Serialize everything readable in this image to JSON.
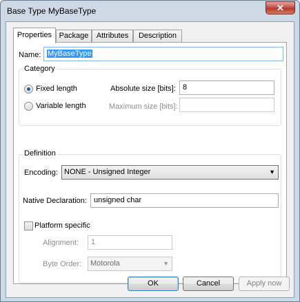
{
  "window": {
    "title": "Base Type MyBaseType",
    "close_glyph": "✕"
  },
  "tabs": [
    {
      "label": "Properties",
      "active": true
    },
    {
      "label": "Package",
      "active": false
    },
    {
      "label": "Attributes",
      "active": false
    },
    {
      "label": "Description",
      "active": false
    }
  ],
  "name": {
    "label": "Name:",
    "value": "MyBaseType"
  },
  "category": {
    "title": "Category",
    "fixed_length": "Fixed length",
    "variable_length": "Variable length",
    "selected": "fixed_length",
    "absolute_size_label": "Absolute size [bits]:",
    "absolute_size_value": "8",
    "maximum_size_label": "Maximum size [bits]:",
    "maximum_size_value": ""
  },
  "definition": {
    "title": "Definition",
    "encoding_label": "Encoding:",
    "encoding_value": "NONE - Unsigned Integer",
    "native_label": "Native Declaration:",
    "native_value": "unsigned char",
    "platform_label": "Platform specific",
    "platform_checked": false,
    "alignment_label": "Alignment:",
    "alignment_value": "1",
    "byte_order_label": "Byte Order:",
    "byte_order_value": "Motorola"
  },
  "buttons": {
    "ok": "OK",
    "cancel": "Cancel",
    "apply": "Apply now"
  },
  "icons": {
    "dropdown_arrow": "▼"
  }
}
